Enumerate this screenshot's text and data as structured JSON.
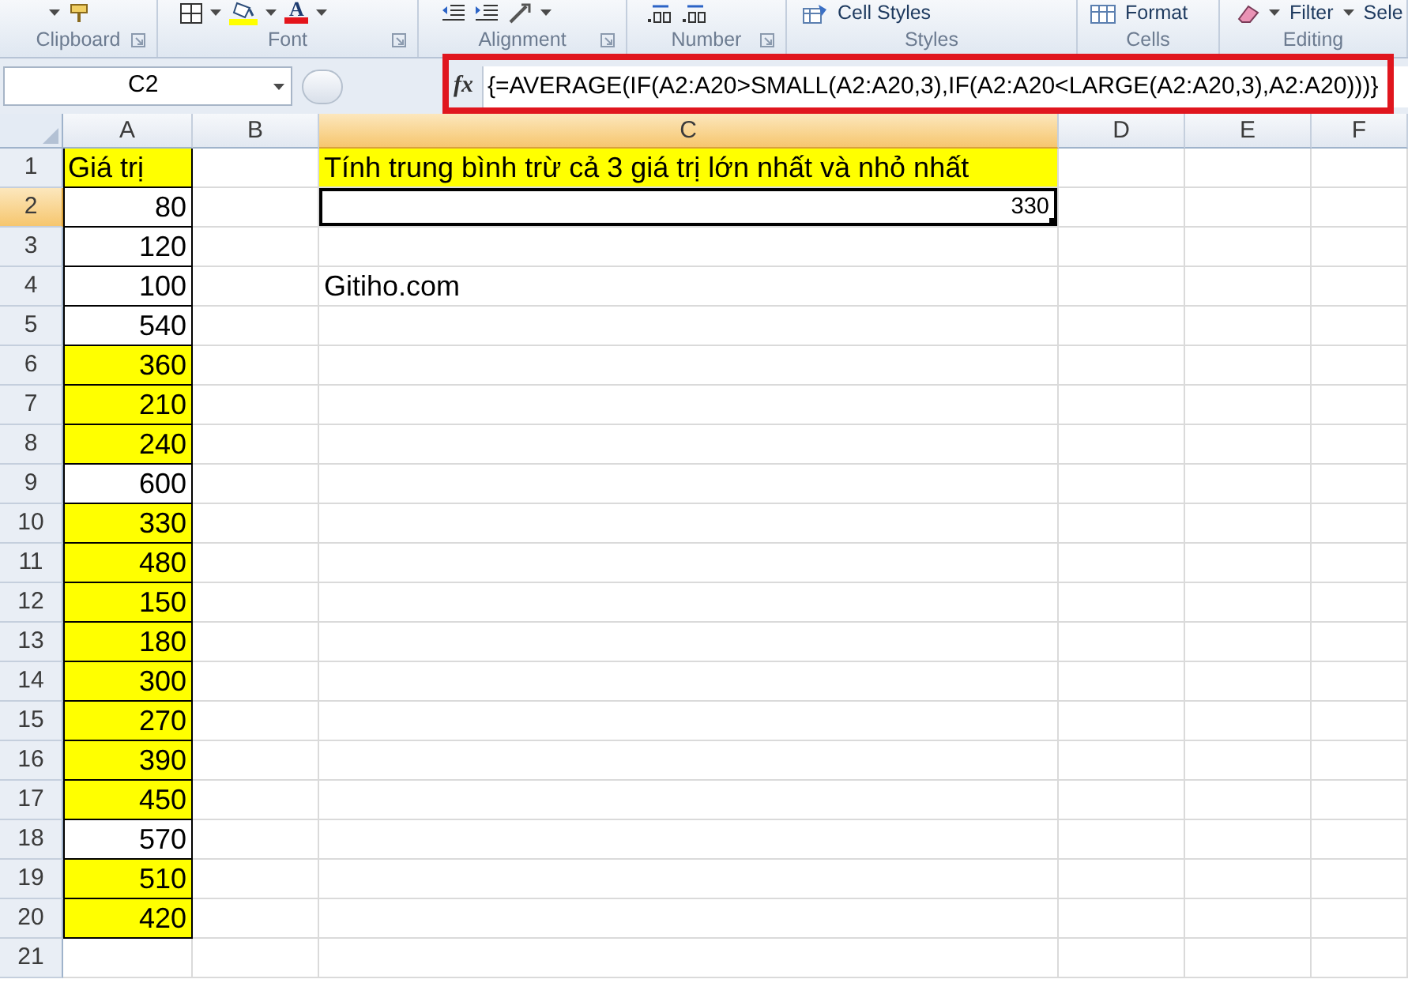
{
  "ribbon": {
    "groups": [
      {
        "label": "Clipboard",
        "launcher": true
      },
      {
        "label": "Font",
        "launcher": true,
        "commands": [
          {
            "text": "A",
            "kind": "font_color",
            "dropdown": true
          }
        ]
      },
      {
        "label": "Alignment",
        "launcher": true
      },
      {
        "label": "Number",
        "launcher": true
      },
      {
        "label": "Styles",
        "launcher": false,
        "commands": [
          {
            "text": "Cell Styles",
            "kind": "button",
            "dropdown": false
          }
        ]
      },
      {
        "label": "Cells",
        "launcher": false,
        "commands": [
          {
            "text": "Format",
            "kind": "button",
            "dropdown": false
          }
        ]
      },
      {
        "label": "Editing",
        "launcher": false,
        "commands": [
          {
            "text": "Filter",
            "kind": "button",
            "dropdown": true
          },
          {
            "text": "Sele",
            "kind": "button",
            "dropdown": false
          }
        ]
      }
    ]
  },
  "formula_bar": {
    "name_box": "C2",
    "function_label": "fx",
    "formula": "{=AVERAGE(IF(A2:A20>SMALL(A2:A20,3),IF(A2:A20<LARGE(A2:A20,3),A2:A20)))}"
  },
  "columns": [
    {
      "label": "A",
      "selected": false
    },
    {
      "label": "B",
      "selected": false
    },
    {
      "label": "C",
      "selected": true
    },
    {
      "label": "D",
      "selected": false
    },
    {
      "label": "E",
      "selected": false
    },
    {
      "label": "F",
      "selected": false
    }
  ],
  "rows": [
    {
      "label": "1",
      "selected": false,
      "a": {
        "text": "Giá trị",
        "kind": "text",
        "highlighted": true,
        "bordered": true,
        "selected": false
      },
      "c": {
        "text": "Tính trung bình trừ cả 3 giá trị lớn nhất và nhỏ nhất",
        "kind": "text",
        "highlighted": true,
        "bordered": false,
        "selected": false
      }
    },
    {
      "label": "2",
      "selected": true,
      "a": {
        "text": "80",
        "kind": "number",
        "highlighted": false,
        "bordered": true,
        "selected": false
      },
      "c": {
        "text": "330",
        "kind": "result",
        "highlighted": false,
        "bordered": false,
        "selected": true
      }
    },
    {
      "label": "3",
      "selected": false,
      "a": {
        "text": "120",
        "kind": "number",
        "highlighted": false,
        "bordered": true,
        "selected": false
      }
    },
    {
      "label": "4",
      "selected": false,
      "a": {
        "text": "100",
        "kind": "number",
        "highlighted": false,
        "bordered": true,
        "selected": false
      },
      "c": {
        "text": "Gitiho.com",
        "kind": "text",
        "highlighted": false,
        "bordered": false,
        "selected": false
      }
    },
    {
      "label": "5",
      "selected": false,
      "a": {
        "text": "540",
        "kind": "number",
        "highlighted": false,
        "bordered": true,
        "selected": false
      }
    },
    {
      "label": "6",
      "selected": false,
      "a": {
        "text": "360",
        "kind": "number",
        "highlighted": true,
        "bordered": true,
        "selected": false
      }
    },
    {
      "label": "7",
      "selected": false,
      "a": {
        "text": "210",
        "kind": "number",
        "highlighted": true,
        "bordered": true,
        "selected": false
      }
    },
    {
      "label": "8",
      "selected": false,
      "a": {
        "text": "240",
        "kind": "number",
        "highlighted": true,
        "bordered": true,
        "selected": false
      }
    },
    {
      "label": "9",
      "selected": false,
      "a": {
        "text": "600",
        "kind": "number",
        "highlighted": false,
        "bordered": true,
        "selected": false
      }
    },
    {
      "label": "10",
      "selected": false,
      "a": {
        "text": "330",
        "kind": "number",
        "highlighted": true,
        "bordered": true,
        "selected": false
      }
    },
    {
      "label": "11",
      "selected": false,
      "a": {
        "text": "480",
        "kind": "number",
        "highlighted": true,
        "bordered": true,
        "selected": false
      }
    },
    {
      "label": "12",
      "selected": false,
      "a": {
        "text": "150",
        "kind": "number",
        "highlighted": true,
        "bordered": true,
        "selected": false
      }
    },
    {
      "label": "13",
      "selected": false,
      "a": {
        "text": "180",
        "kind": "number",
        "highlighted": true,
        "bordered": true,
        "selected": false
      }
    },
    {
      "label": "14",
      "selected": false,
      "a": {
        "text": "300",
        "kind": "number",
        "highlighted": true,
        "bordered": true,
        "selected": false
      }
    },
    {
      "label": "15",
      "selected": false,
      "a": {
        "text": "270",
        "kind": "number",
        "highlighted": true,
        "bordered": true,
        "selected": false
      }
    },
    {
      "label": "16",
      "selected": false,
      "a": {
        "text": "390",
        "kind": "number",
        "highlighted": true,
        "bordered": true,
        "selected": false
      }
    },
    {
      "label": "17",
      "selected": false,
      "a": {
        "text": "450",
        "kind": "number",
        "highlighted": true,
        "bordered": true,
        "selected": false
      }
    },
    {
      "label": "18",
      "selected": false,
      "a": {
        "text": "570",
        "kind": "number",
        "highlighted": false,
        "bordered": true,
        "selected": false
      }
    },
    {
      "label": "19",
      "selected": false,
      "a": {
        "text": "510",
        "kind": "number",
        "highlighted": true,
        "bordered": true,
        "selected": false
      }
    },
    {
      "label": "20",
      "selected": false,
      "a": {
        "text": "420",
        "kind": "number",
        "highlighted": true,
        "bordered": true,
        "selected": false
      }
    },
    {
      "label": "21",
      "selected": false
    }
  ]
}
